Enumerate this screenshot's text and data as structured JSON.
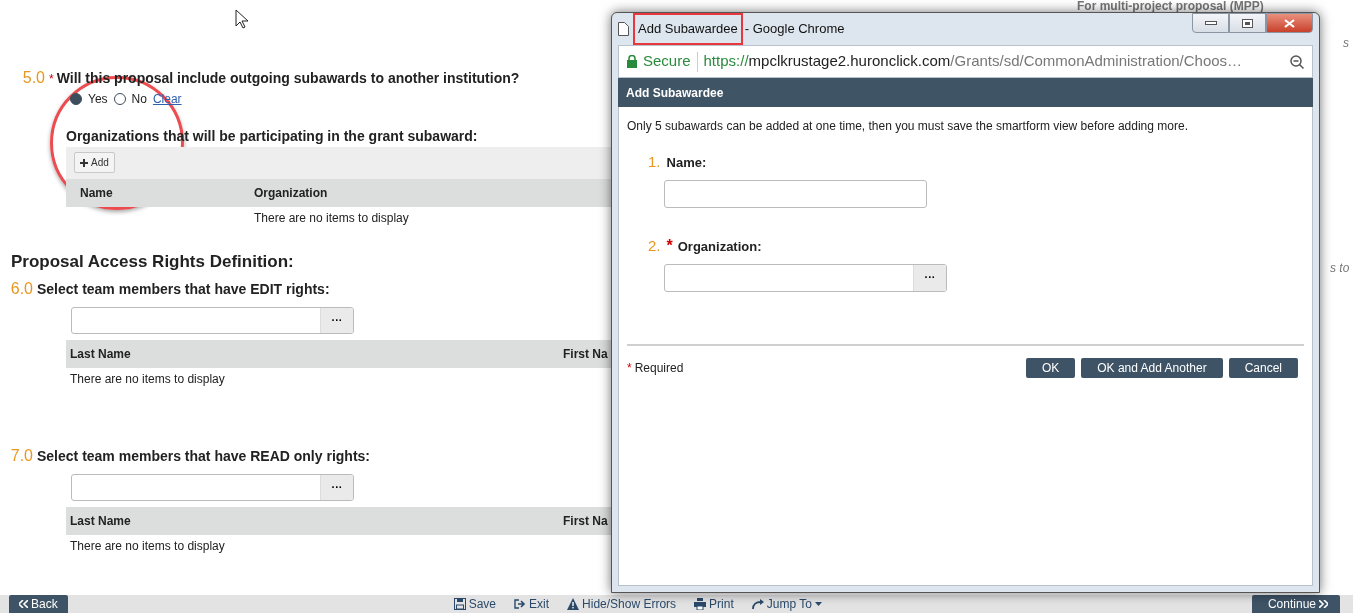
{
  "page": {
    "question_5": {
      "number": "5.0",
      "required_mark": "*",
      "text": "Will this proposal include outgoing subawards to another institution?",
      "options": [
        {
          "label": "Yes",
          "selected": true
        },
        {
          "label": "No",
          "selected": false
        }
      ],
      "clear_link": "Clear",
      "subaward_table": {
        "title": "Organizations that will be participating in the grant subaward:",
        "add_button": "Add",
        "columns": [
          "Name",
          "Organization"
        ],
        "empty_text": "There are no items to display"
      }
    },
    "section_title": "Proposal Access Rights Definition:",
    "team_questions": [
      {
        "number": "6.0",
        "text": "Select team members that have EDIT rights:",
        "picker_button": "···",
        "columns": [
          "Last Name",
          "First Na"
        ],
        "empty_text": "There are no items to display"
      },
      {
        "number": "7.0",
        "text": "Select team members that have READ only rights:",
        "picker_button": "···",
        "columns": [
          "Last Name",
          "First Na"
        ],
        "empty_text": "There are no items to display"
      }
    ],
    "side_notes": [
      "For multi-project proposal (MPP)",
      "s",
      "s to"
    ]
  },
  "bottom_bar": {
    "back": "Back",
    "actions": [
      {
        "label": "Save",
        "kind": "save"
      },
      {
        "label": "Exit",
        "kind": "exit"
      },
      {
        "label": "Hide/Show Errors",
        "kind": "errors"
      },
      {
        "label": "Print",
        "kind": "print"
      },
      {
        "label": "Jump To",
        "kind": "jump"
      }
    ],
    "continue": "Continue"
  },
  "popup": {
    "window_title": [
      "Add Subawardee",
      "- Google Chrome"
    ],
    "secure_label": "Secure",
    "url": {
      "scheme": "https://",
      "host": "mpclkrustage2.huronclick.com",
      "path": "/Grants/sd/CommonAdministration/Choos…"
    },
    "dialog_title": "Add Subawardee",
    "note": "Only 5 subawards can be added at one time, then you must save the smartform view before adding more.",
    "fields": [
      {
        "number": "1.",
        "label": "Name:",
        "kind": "text"
      },
      {
        "number": "2.",
        "label": "Organization:",
        "required_mark": "*",
        "kind": "picker",
        "picker_button": "···"
      }
    ],
    "required_note": {
      "mark": "*",
      "text": "Required"
    },
    "buttons": [
      "OK",
      "OK and Add Another",
      "Cancel"
    ]
  }
}
